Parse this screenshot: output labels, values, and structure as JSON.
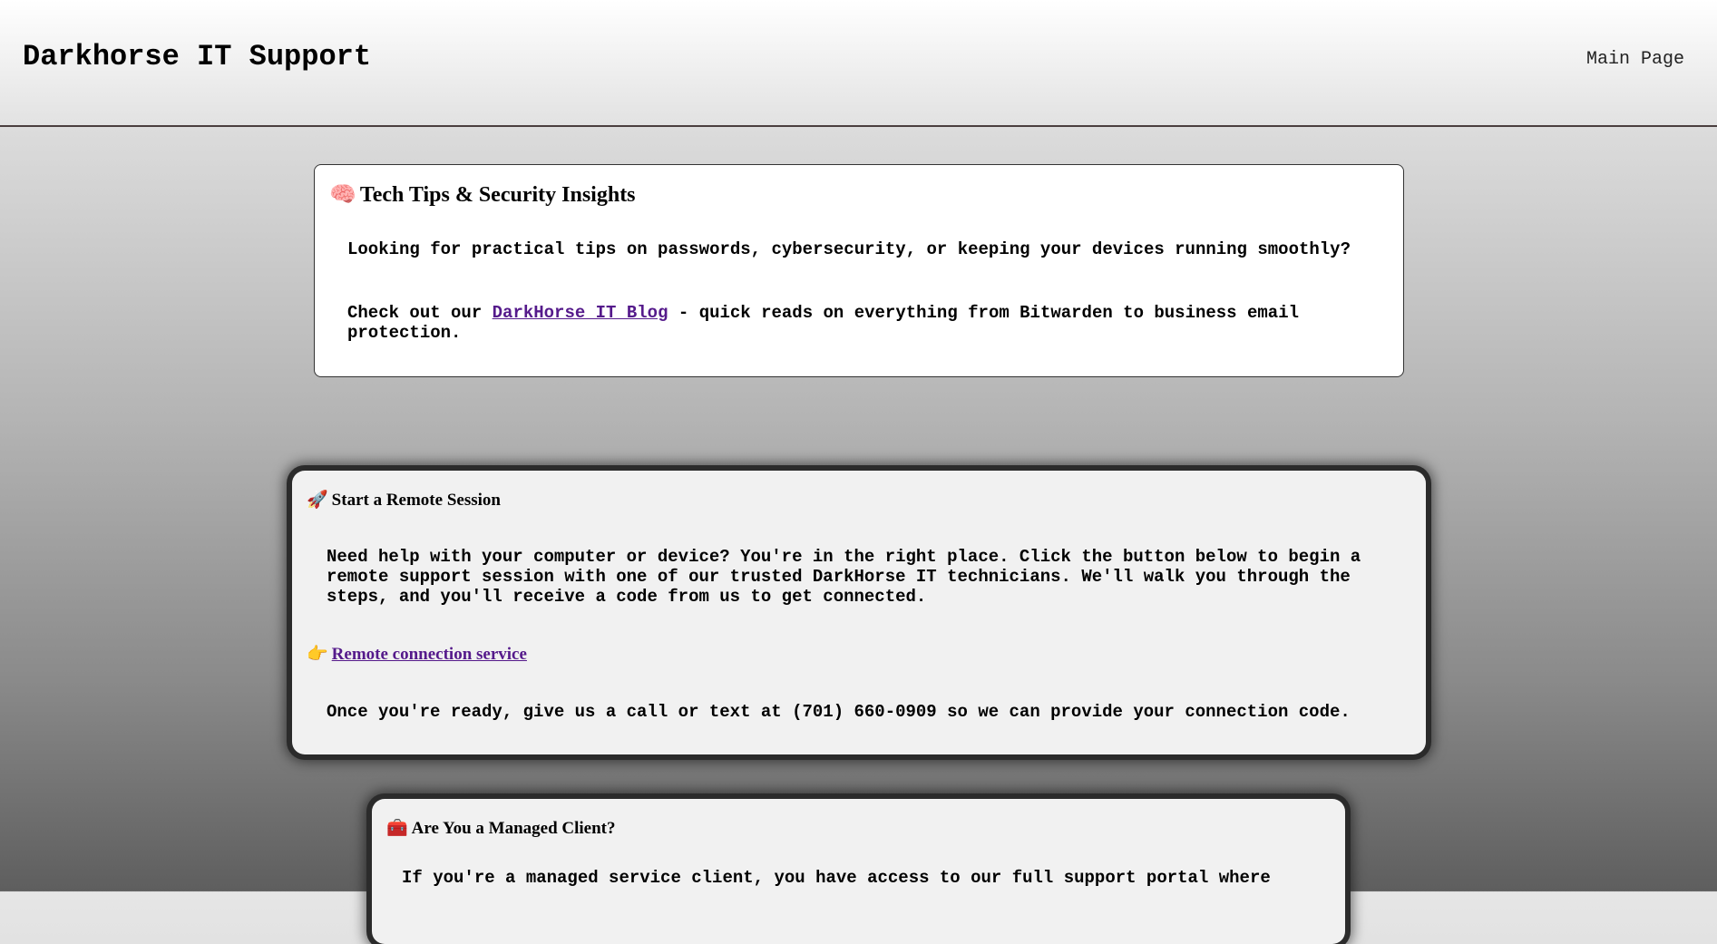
{
  "header": {
    "title": "Darkhorse IT Support",
    "nav": [
      {
        "label": "Main Page"
      }
    ]
  },
  "tips": {
    "icon": "brain-icon",
    "icon_glyph": "🧠",
    "heading": "Tech Tips & Security Insights",
    "intro": "Looking for practical tips on passwords, cybersecurity, or keeping your devices running smoothly?",
    "blog_prefix": "Check out our ",
    "blog_link": "DarkHorse IT Blog",
    "blog_suffix": " - quick reads on everything from Bitwarden to business email protection."
  },
  "remote": {
    "icon": "rocket-icon",
    "icon_glyph": "🚀",
    "heading": "Start a Remote Session",
    "description": "Need help with your computer or device? You're in the right place. Click the button below to begin a remote support session with one of our trusted DarkHorse IT technicians. We'll walk you through the steps, and you'll receive a code from us to get connected.",
    "link_icon": "pointing-hand-icon",
    "link_icon_glyph": "👉",
    "link_label": "Remote connection service",
    "contact_text": "Once you're ready, give us a call or text at (701) 660-0909 so we can provide your connection code."
  },
  "managed": {
    "icon": "toolbox-icon",
    "icon_glyph": "🧰",
    "heading": "Are You a Managed Client?",
    "description": "If you're a managed service client, you have access to our full support portal where"
  },
  "colors": {
    "link": "#551a8b",
    "header_border": "#4a3e3e",
    "card_frame": "#2b2b2b"
  }
}
